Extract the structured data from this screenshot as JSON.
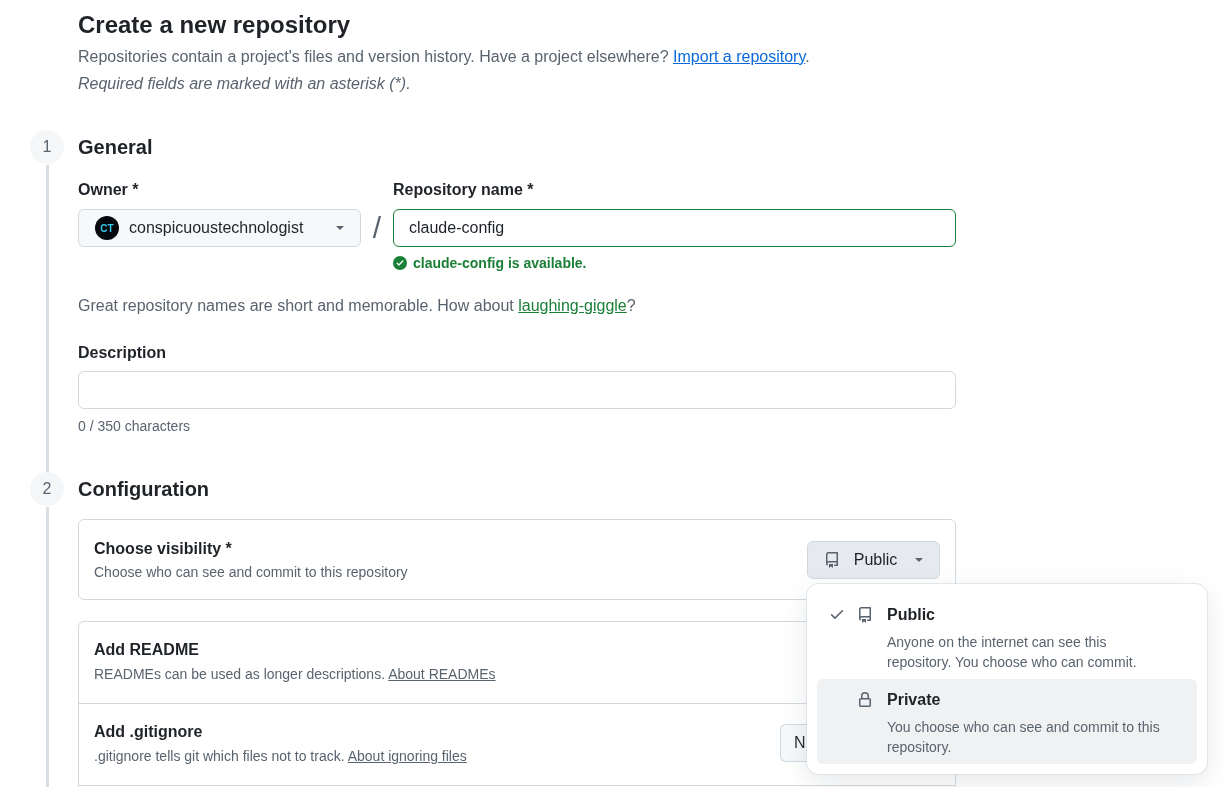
{
  "header": {
    "title": "Create a new repository",
    "intro": {
      "text": "Repositories contain a project's files and version history. Have a project elsewhere?",
      "link": "Import a repository",
      "end": "."
    },
    "required_note": "Required fields are marked with an asterisk (*)."
  },
  "general": {
    "step": "1",
    "title": "General",
    "owner": {
      "label": "Owner *",
      "avatar_text": "CT",
      "value": "conspicuoustechnologist"
    },
    "separator": "/",
    "repository_name": {
      "label": "Repository name *",
      "value": "claude-config",
      "valid": true,
      "status": "claude-config is available."
    },
    "name_hint": {
      "text": "Great repository names are short and memorable. How about",
      "suggestion": "laughing-giggle",
      "end": "?"
    },
    "description": {
      "label": "Description",
      "counter": "0 / 350 characters"
    }
  },
  "configuration": {
    "step": "2",
    "title": "Configuration",
    "visibility": {
      "title": "Choose visibility *",
      "description": "Choose who can see and commit to this repository",
      "button": "Public",
      "menu_open": true,
      "options": [
        {
          "kind": "public",
          "label": "Public",
          "description": "Anyone on the internet can see this repository. You choose who can commit.",
          "selected": true,
          "highlighted": false
        },
        {
          "kind": "private",
          "label": "Private",
          "description": "You choose who can see and commit to this repository.",
          "selected": false,
          "highlighted": true
        }
      ]
    },
    "settings": [
      {
        "title": "Add README",
        "description": "READMEs can be used as longer descriptions.",
        "link": "About READMEs"
      },
      {
        "title": "Add .gitignore",
        "description": ".gitignore tells git which files not to track.",
        "link": "About ignoring files",
        "button": "N"
      }
    ]
  }
}
